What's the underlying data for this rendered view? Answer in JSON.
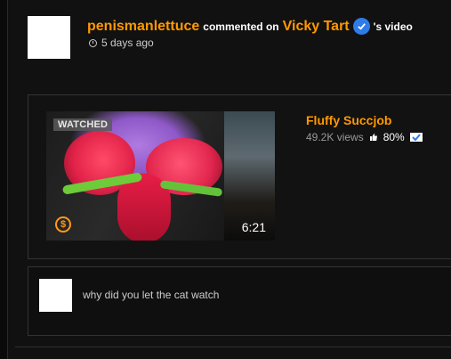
{
  "activity": {
    "commenter_name": "penismanlettuce",
    "action_text": "commented on",
    "channel_name": "Vicky Tart",
    "suffix_text": "'s video",
    "time_ago": "5 days ago"
  },
  "video": {
    "watched_label": "WATCHED",
    "duration": "6:21",
    "title": "Fluffy Succjob",
    "views": "49.2K views",
    "rating": "80%"
  },
  "reply": {
    "text": "why did you let the cat watch"
  },
  "colors": {
    "accent": "#ff9900",
    "verified_blue": "#2f7be8",
    "background": "#111111"
  },
  "icons": {
    "verified": "verified-check-icon",
    "clock": "clock-icon",
    "thumbs_up": "thumbs-up-icon",
    "checkbox": "check-box-icon",
    "coin": "dollar-coin-icon"
  }
}
